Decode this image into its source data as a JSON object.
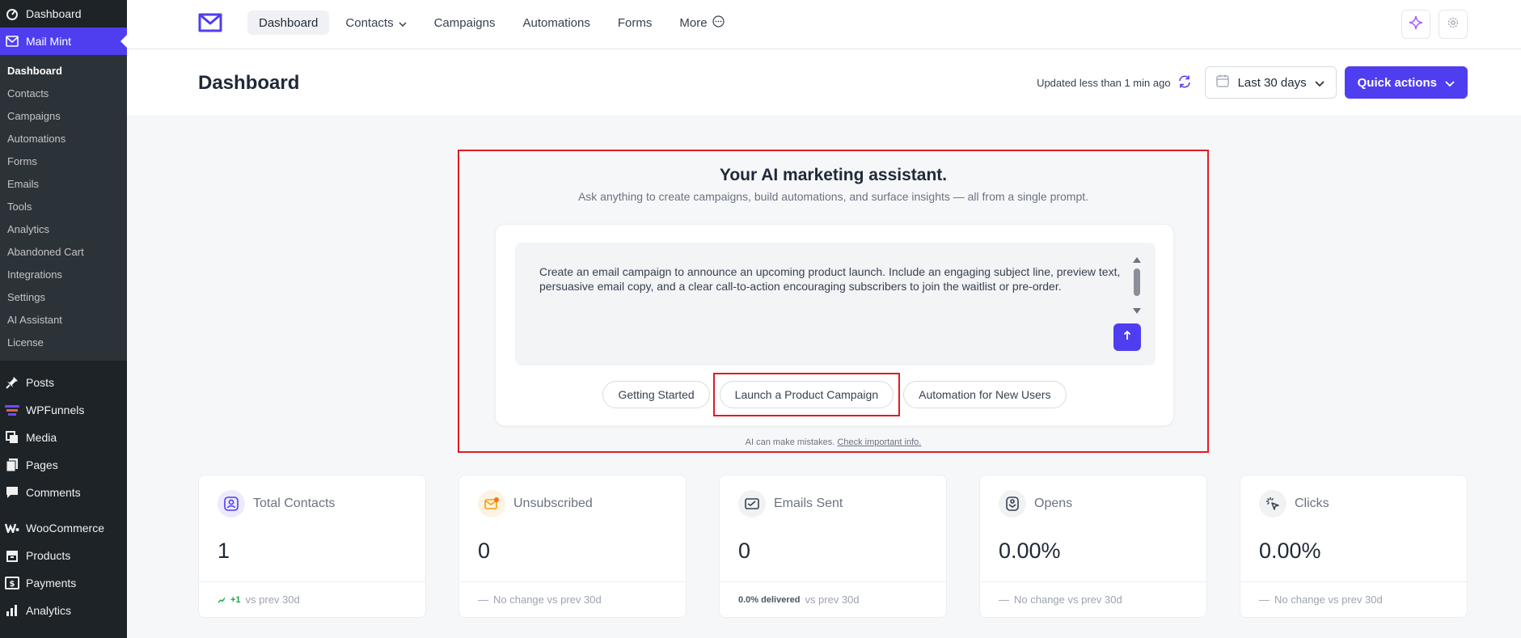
{
  "sidebar": {
    "top": [
      {
        "label": "Dashboard",
        "icon": "dashboard-icon"
      },
      {
        "label": "Mail Mint",
        "icon": "mail-icon"
      }
    ],
    "submenu": [
      "Dashboard",
      "Contacts",
      "Campaigns",
      "Automations",
      "Forms",
      "Emails",
      "Tools",
      "Analytics",
      "Abandoned Cart",
      "Integrations",
      "Settings",
      "AI Assistant",
      "License"
    ],
    "lower": [
      {
        "label": "Posts",
        "icon": "pin-icon"
      },
      {
        "label": "WPFunnels",
        "icon": "funnel-icon"
      },
      {
        "label": "Media",
        "icon": "media-icon"
      },
      {
        "label": "Pages",
        "icon": "pages-icon"
      },
      {
        "label": "Comments",
        "icon": "comment-icon"
      },
      {
        "label": "WooCommerce",
        "icon": "woo-icon"
      },
      {
        "label": "Products",
        "icon": "box-icon"
      },
      {
        "label": "Payments",
        "icon": "dollar-icon"
      },
      {
        "label": "Analytics",
        "icon": "bar-chart-icon"
      }
    ]
  },
  "topnav": {
    "items": [
      "Dashboard",
      "Contacts",
      "Campaigns",
      "Automations",
      "Forms",
      "More"
    ]
  },
  "header": {
    "title": "Dashboard",
    "updated": "Updated less than 1 min ago",
    "date_range": "Last 30 days",
    "quick_actions": "Quick actions"
  },
  "ai": {
    "title": "Your AI marketing assistant.",
    "subtitle": "Ask anything to create campaigns, build automations, and surface insights — all from a single prompt.",
    "prompt": "Create an email campaign to announce an upcoming product launch. Include an engaging subject line, preview text, persuasive email copy, and a clear call-to-action encouraging subscribers to join the waitlist or pre-order.",
    "suggestions": [
      "Getting Started",
      "Launch a Product Campaign",
      "Automation for New Users"
    ],
    "disclaimer": "AI can make mistakes.",
    "disclaimer_link": "Check important info."
  },
  "stats": [
    {
      "label": "Total Contacts",
      "value": "1",
      "delta": "+1",
      "foot": "vs prev 30d",
      "icon_color": "#ecebfd",
      "accent": "#4f3ef0"
    },
    {
      "label": "Unsubscribed",
      "value": "0",
      "delta": "—",
      "foot": "No change vs prev 30d",
      "icon_color": "#fdf3e4",
      "accent": "#f59e0b"
    },
    {
      "label": "Emails Sent",
      "value": "0",
      "delta": "0.0% delivered",
      "foot": "vs prev 30d",
      "icon_color": "#f1f2f4",
      "accent": "#374151"
    },
    {
      "label": "Opens",
      "value": "0.00%",
      "delta": "—",
      "foot": "No change vs prev 30d",
      "icon_color": "#f1f2f4",
      "accent": "#374151"
    },
    {
      "label": "Clicks",
      "value": "0.00%",
      "delta": "—",
      "foot": "No change vs prev 30d",
      "icon_color": "#f1f2f4",
      "accent": "#374151"
    }
  ]
}
